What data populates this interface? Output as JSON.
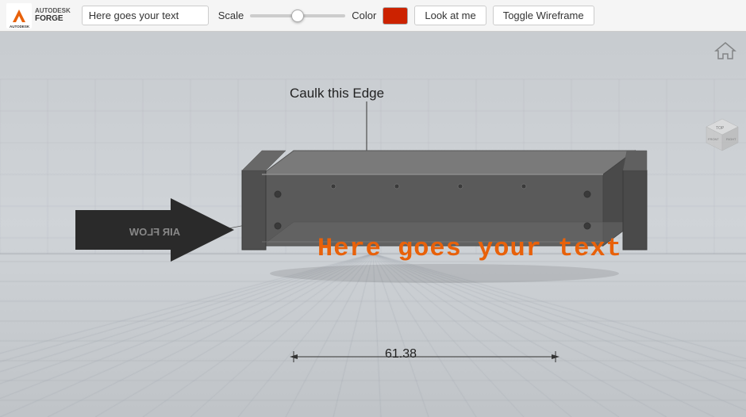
{
  "toolbar": {
    "logo_alt": "Autodesk Forge",
    "text_input_value": "Here goes your text",
    "text_input_placeholder": "Here goes your text",
    "scale_label": "Scale",
    "scale_value": 50,
    "color_label": "Color",
    "color_value": "#cc2200",
    "look_at_me_label": "Look at me",
    "toggle_wireframe_label": "Toggle Wireframe"
  },
  "viewport": {
    "caulk_label": "Caulk this Edge",
    "viewport_text": "Here goes your text",
    "dimension_value": "61.38",
    "home_icon": "home-icon"
  }
}
